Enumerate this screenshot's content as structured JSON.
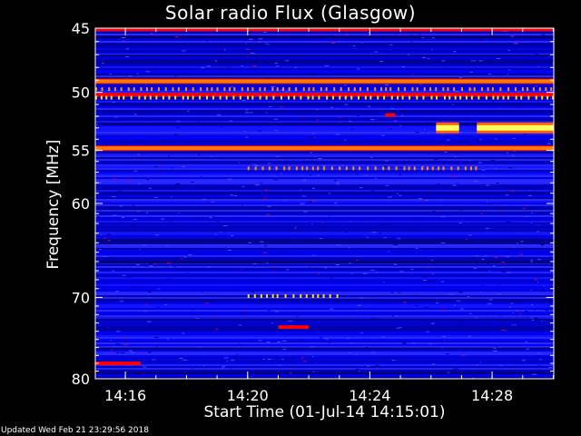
{
  "chart_data": {
    "type": "heatmap",
    "title": "Solar radio Flux (Glasgow)",
    "xlabel": "Start Time (01-Jul-14 14:15:01)",
    "ylabel": "Frequency [MHz]",
    "y_scale": "log",
    "y_inverted": true,
    "ylim": [
      45,
      80
    ],
    "y_ticks": [
      45,
      50,
      55,
      60,
      70,
      80
    ],
    "y_minor_ticks": [
      46,
      47,
      48,
      49,
      51,
      52,
      53,
      54,
      56,
      57,
      58,
      59,
      61,
      62,
      63,
      64,
      65,
      66,
      67,
      68,
      69,
      71,
      72,
      73,
      74,
      75,
      76,
      77,
      78,
      79
    ],
    "xlim": [
      "14:15:01",
      "14:30:01"
    ],
    "x_ticks": [
      "14:16",
      "14:20",
      "14:24",
      "14:28"
    ],
    "colormap": [
      "#000040",
      "#0000ff",
      "#3040ff",
      "#ff0000",
      "#ffa000",
      "#ffff00"
    ],
    "bands": [
      {
        "freq": 45.1,
        "start": "14:15:01",
        "end": "14:30:01",
        "level": "red"
      },
      {
        "freq": 49.1,
        "start": "14:15:01",
        "end": "14:30:01",
        "level": "orange"
      },
      {
        "freq": 49.7,
        "start": "14:15:01",
        "end": "14:30:01",
        "level": "dotted-orange"
      },
      {
        "freq": 50.2,
        "start": "14:15:01",
        "end": "14:30:01",
        "level": "red"
      },
      {
        "freq": 50.4,
        "start": "14:15:01",
        "end": "14:30:01",
        "level": "dotted-yellow"
      },
      {
        "freq": 54.8,
        "start": "14:15:01",
        "end": "14:30:01",
        "level": "orange"
      },
      {
        "freq": 56.6,
        "start": "14:20:00",
        "end": "14:27:30",
        "level": "dotted-orange"
      },
      {
        "freq": 69.8,
        "start": "14:20:00",
        "end": "14:23:00",
        "level": "dotted-yellow"
      },
      {
        "freq": 53.0,
        "start": "14:26:10",
        "end": "14:26:55",
        "level": "yellow"
      },
      {
        "freq": 53.0,
        "start": "14:27:30",
        "end": "14:30:01",
        "level": "yellow"
      },
      {
        "freq": 51.9,
        "start": "14:24:30",
        "end": "14:24:50",
        "level": "red"
      },
      {
        "freq": 73.5,
        "start": "14:21:00",
        "end": "14:22:00",
        "level": "red"
      },
      {
        "freq": 78.0,
        "start": "14:15:01",
        "end": "14:16:30",
        "level": "red"
      }
    ]
  },
  "footer": "Updated Wed Feb 21 23:29:56 2018"
}
